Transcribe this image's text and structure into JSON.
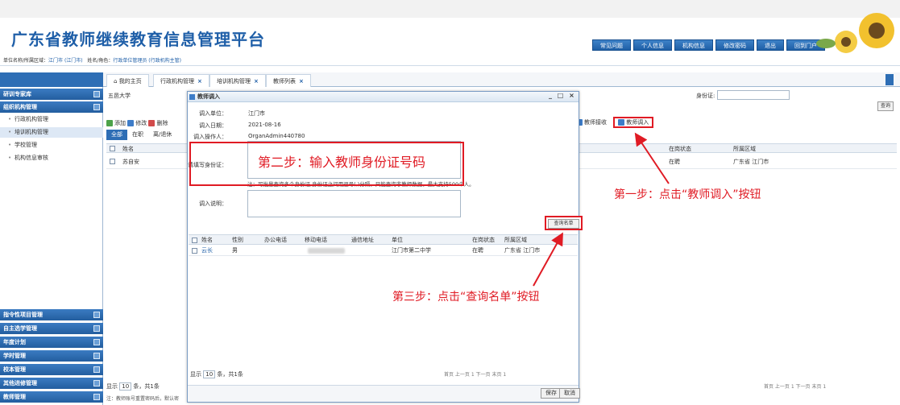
{
  "header": {
    "site_title": "广东省教师继续教育信息管理平台",
    "nav": [
      "常见问题",
      "个人信息",
      "机构信息",
      "修改密码",
      "退出",
      "回到门户"
    ]
  },
  "info_bar": {
    "unit_label": "单位名称/所属区域：",
    "unit_value": "江门市 (江门市)",
    "role_label": "姓名/角色：",
    "role_value": "行政单位管理员 (行政机构主管)"
  },
  "sidebar": {
    "top_sections": [
      "研训专家库",
      "组织机构管理"
    ],
    "sub_items": [
      "行政机构管理",
      "培训机构管理",
      "学校管理",
      "机构信息审核"
    ],
    "bottom_sections": [
      "指令性项目管理",
      "自主选学管理",
      "年度计划",
      "学时管理",
      "校本管理",
      "其他进修管理",
      "教师管理"
    ]
  },
  "tabs": [
    {
      "label": "我的主页"
    },
    {
      "label": "行政机构管理"
    },
    {
      "label": "培训机构管理"
    },
    {
      "label": "教师列表"
    }
  ],
  "background": {
    "org_name": "五邑大学",
    "id_label": "身份证:",
    "query_btn": "查询",
    "tools": [
      "添加",
      "修改",
      "删除"
    ],
    "subtabs": [
      "全部",
      "在职",
      "离/退休"
    ],
    "toolbar_right": {
      "receive": "教师接收",
      "transfer_in": "教师调入"
    },
    "columns": {
      "name": "姓名",
      "in_post": "在岗状态",
      "region": "所属区域"
    },
    "row": {
      "name": "苏自安",
      "status": "在聘",
      "region": "广东省 江门市"
    },
    "footer_show": "显示",
    "footer_page_size": "10",
    "footer_total": "条，共1条",
    "note": "注：教师账号重置密码后，默认密",
    "pager": "首页 上一页 1 下一页 末页 1"
  },
  "dialog": {
    "title": "教师调入",
    "win_buttons": "_ □ ×",
    "fields": [
      {
        "label": "调入单位：",
        "value": "江门市"
      },
      {
        "label": "调入日期：",
        "value": "2021-08-16"
      },
      {
        "label": "调入操作人：",
        "value": "OrganAdmin440780"
      }
    ],
    "id_label": "请填写身份证：",
    "note": "注：可批量查询多个身份证,身份证之间用逗号(,)分隔，只能查询非教师数据，最大支持500个人。",
    "reason_label": "调入说明：",
    "search_btn": "查询名单",
    "table_headers": [
      "姓名",
      "性别",
      "办公电话",
      "移动电话",
      "通信地址",
      "单位",
      "在岗状态",
      "所属区域"
    ],
    "rows": [
      {
        "name": "云长",
        "gender": "男",
        "office_phone": "",
        "address": "",
        "unit": "江门市第二中学",
        "status": "在聘",
        "region": "广东省 江门市"
      }
    ],
    "pager_show": "显示",
    "pager_size": "10",
    "pager_total": "条，共1条",
    "pager_nav": "首页 上一页 1 下一页 末页 1",
    "save": "保存",
    "cancel": "取消"
  },
  "annotations": {
    "step1": "第一步：点击“教师调入”按钮",
    "step2": "第二步：输入教师身份证号码",
    "step3": "第三步：点击“查询名单”按钮",
    "color": "#e01b24"
  },
  "colors": {
    "brand_blue": "#1f5fa8",
    "nav_blue": "#2e6eb5",
    "accent_red": "#e01b24"
  }
}
